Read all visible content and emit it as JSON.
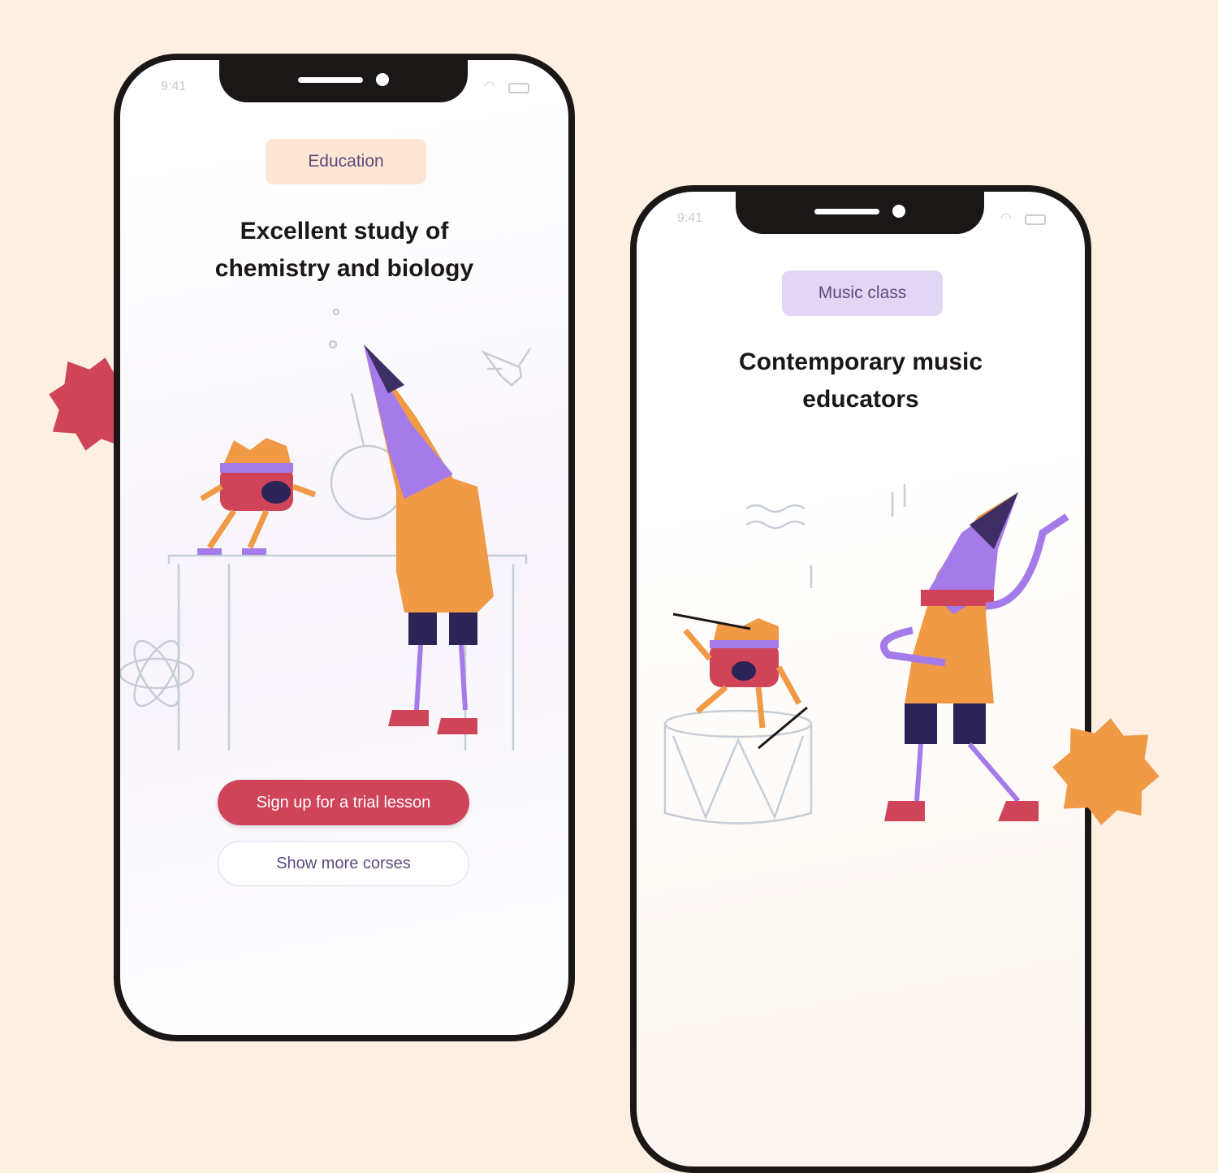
{
  "phones": [
    {
      "status": {
        "time": "9:41",
        "wifi_icon": "wifi-icon",
        "battery_icon": "battery-icon"
      },
      "badge": "Education",
      "title_line1": "Excellent study of",
      "title_line2": "chemistry and biology",
      "primary_button": "Sign up for a trial lesson",
      "secondary_button": "Show more corses"
    },
    {
      "status": {
        "time": "9:41",
        "wifi_icon": "wifi-icon",
        "battery_icon": "battery-icon"
      },
      "badge": "Music class",
      "title_line1": "Contemporary music",
      "title_line2": "educators"
    }
  ],
  "colors": {
    "background": "#fdf0e2",
    "accent_red": "#cf4459",
    "badge_education": "#fde6d3",
    "badge_music": "#e2d6f5",
    "text_purple": "#5e4a7e",
    "star_orange": "#f09a46"
  }
}
